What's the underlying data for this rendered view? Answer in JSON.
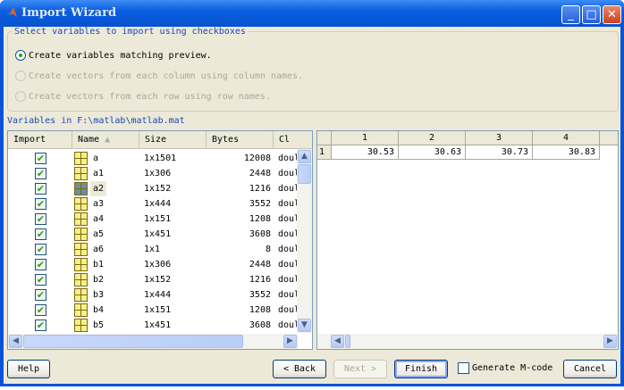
{
  "window": {
    "title": "Import Wizard"
  },
  "options": {
    "group_label": "Select variables to import using checkboxes",
    "radios": [
      {
        "label": "Create variables matching preview.",
        "selected": true,
        "enabled": true
      },
      {
        "label": "Create vectors from each column using column names.",
        "selected": false,
        "enabled": false
      },
      {
        "label": "Create vectors from each row using row names.",
        "selected": false,
        "enabled": false
      }
    ]
  },
  "variables": {
    "label": "Variables in F:\\matlab\\matlab.mat",
    "columns": [
      "Import",
      "Name",
      "Size",
      "Bytes",
      "Cl"
    ],
    "sort_indicator": "▲",
    "rows": [
      {
        "checked": true,
        "name": "a",
        "size": "1x1501",
        "bytes": "12008",
        "class": "doul"
      },
      {
        "checked": true,
        "name": "a1",
        "size": "1x306",
        "bytes": "2448",
        "class": "doul"
      },
      {
        "checked": true,
        "name": "a2",
        "size": "1x152",
        "bytes": "1216",
        "class": "doul",
        "selected": true
      },
      {
        "checked": true,
        "name": "a3",
        "size": "1x444",
        "bytes": "3552",
        "class": "doul"
      },
      {
        "checked": true,
        "name": "a4",
        "size": "1x151",
        "bytes": "1208",
        "class": "doul"
      },
      {
        "checked": true,
        "name": "a5",
        "size": "1x451",
        "bytes": "3608",
        "class": "doul"
      },
      {
        "checked": true,
        "name": "a6",
        "size": "1x1",
        "bytes": "8",
        "class": "doul"
      },
      {
        "checked": true,
        "name": "b1",
        "size": "1x306",
        "bytes": "2448",
        "class": "doul"
      },
      {
        "checked": true,
        "name": "b2",
        "size": "1x152",
        "bytes": "1216",
        "class": "doul"
      },
      {
        "checked": true,
        "name": "b3",
        "size": "1x444",
        "bytes": "3552",
        "class": "doul"
      },
      {
        "checked": true,
        "name": "b4",
        "size": "1x151",
        "bytes": "1208",
        "class": "doul"
      },
      {
        "checked": true,
        "name": "b5",
        "size": "1x451",
        "bytes": "3608",
        "class": "doul"
      }
    ]
  },
  "preview": {
    "col_headers": [
      "1",
      "2",
      "3",
      "4"
    ],
    "row_headers": [
      "1"
    ],
    "values": [
      [
        "30.53",
        "30.63",
        "30.73",
        "30.83"
      ]
    ]
  },
  "buttons": {
    "help": "Help",
    "back": "< Back",
    "next": "Next >",
    "finish": "Finish",
    "generate": "Generate M-code",
    "cancel": "Cancel"
  }
}
